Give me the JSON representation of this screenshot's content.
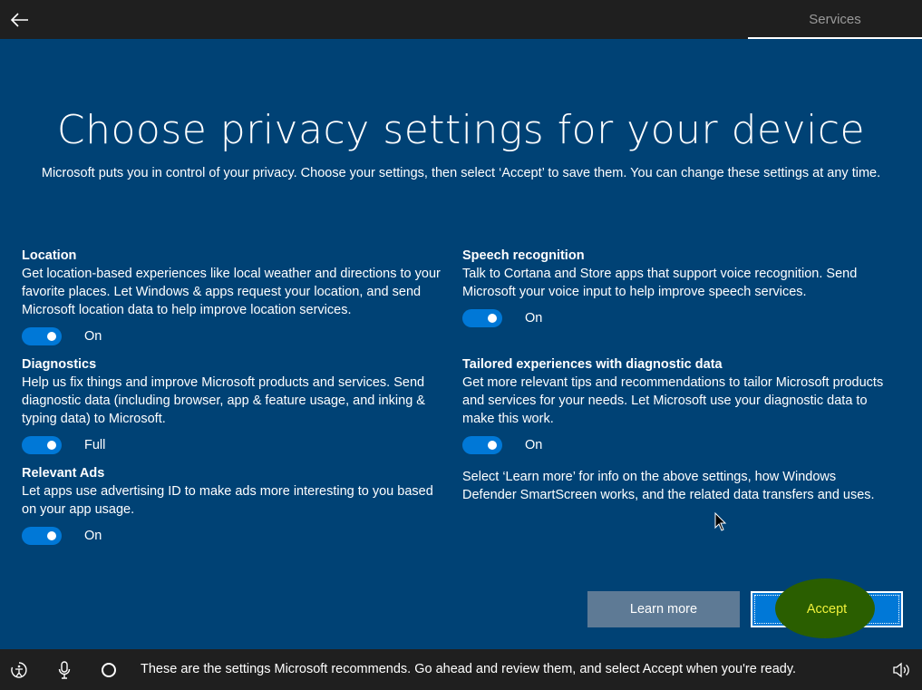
{
  "header": {
    "tab_label": "Services"
  },
  "main": {
    "title": "Choose privacy settings for your device",
    "subtitle": "Microsoft puts you in control of your privacy. Choose your settings, then select ‘Accept’ to save them. You can change these settings at any time.",
    "settings": [
      {
        "title": "Location",
        "description": "Get location-based experiences like local weather and directions to your favorite places. Let Windows & apps request your location, and send Microsoft location data to help improve location services.",
        "state": "On"
      },
      {
        "title": "Diagnostics",
        "description": "Help us fix things and improve Microsoft products and services. Send diagnostic data (including browser, app & feature usage, and inking & typing data) to Microsoft.",
        "state": "Full"
      },
      {
        "title": "Relevant Ads",
        "description": "Let apps use advertising ID to make ads more interesting to you based on your app usage.",
        "state": "On"
      },
      {
        "title": "Speech recognition",
        "description": "Talk to Cortana and Store apps that support voice recognition. Send Microsoft your voice input to help improve speech services.",
        "state": "On"
      },
      {
        "title": "Tailored experiences with diagnostic data",
        "description": "Get more relevant tips and recommendations to tailor Microsoft products and services for your needs. Let Microsoft use your diagnostic data to make this work.",
        "state": "On"
      }
    ],
    "info_text": "Select ‘Learn more’ for info on the above settings, how Windows Defender SmartScreen works, and the related data transfers and uses.",
    "learn_more_label": "Learn more",
    "accept_label": "Accept"
  },
  "footer": {
    "narration": "These are the settings Microsoft recommends. Go ahead and review them, and select Accept when you're ready.",
    "icons": [
      "ease-of-access-icon",
      "microphone-icon",
      "cortana-icon",
      "volume-icon"
    ]
  },
  "colors": {
    "background": "#004275",
    "bar": "#1f1f1f",
    "toggle_on": "#0078d7",
    "accept_button": "#0078d7",
    "learn_more_button": "#5e7a95",
    "highlight": "#2a5e00",
    "highlight_text": "#f0f23a"
  }
}
